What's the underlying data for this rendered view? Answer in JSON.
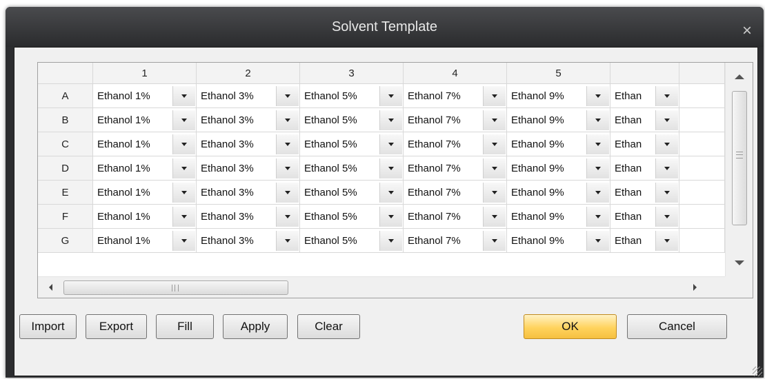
{
  "window": {
    "title": "Solvent Template",
    "close_glyph": "×"
  },
  "grid": {
    "column_headers": [
      "1",
      "2",
      "3",
      "4",
      "5",
      ""
    ],
    "row_headers": [
      "A",
      "B",
      "C",
      "D",
      "E",
      "F",
      "G"
    ],
    "cells": [
      [
        "Ethanol 1%",
        "Ethanol 3%",
        "Ethanol 5%",
        "Ethanol 7%",
        "Ethanol 9%",
        "Ethan"
      ],
      [
        "Ethanol 1%",
        "Ethanol 3%",
        "Ethanol 5%",
        "Ethanol 7%",
        "Ethanol 9%",
        "Ethan"
      ],
      [
        "Ethanol 1%",
        "Ethanol 3%",
        "Ethanol 5%",
        "Ethanol 7%",
        "Ethanol 9%",
        "Ethan"
      ],
      [
        "Ethanol 1%",
        "Ethanol 3%",
        "Ethanol 5%",
        "Ethanol 7%",
        "Ethanol 9%",
        "Ethan"
      ],
      [
        "Ethanol 1%",
        "Ethanol 3%",
        "Ethanol 5%",
        "Ethanol 7%",
        "Ethanol 9%",
        "Ethan"
      ],
      [
        "Ethanol 1%",
        "Ethanol 3%",
        "Ethanol 5%",
        "Ethanol 7%",
        "Ethanol 9%",
        "Ethan"
      ],
      [
        "Ethanol 1%",
        "Ethanol 3%",
        "Ethanol 5%",
        "Ethanol 7%",
        "Ethanol 9%",
        "Ethan"
      ]
    ]
  },
  "buttons": {
    "import": "Import",
    "export": "Export",
    "fill": "Fill",
    "apply": "Apply",
    "clear": "Clear",
    "ok": "OK",
    "cancel": "Cancel"
  },
  "colors": {
    "titlebar": "#2c2d2f",
    "ok_button": "#ffd35e"
  },
  "icons": {
    "combo_dropdown": "chevron-down-icon",
    "close": "close-icon"
  }
}
